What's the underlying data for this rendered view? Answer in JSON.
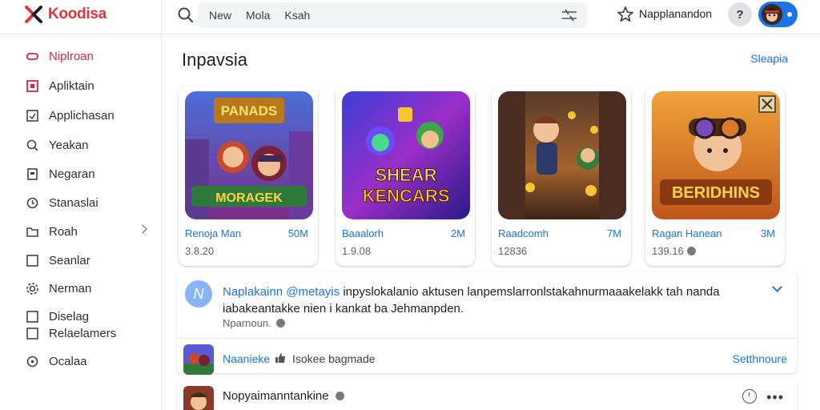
{
  "brand": {
    "name": "Koodisa",
    "accent": "#e53238"
  },
  "sidebar": {
    "items": [
      {
        "label": "Niplroan",
        "icon": "home-icon",
        "active": true
      },
      {
        "label": "Apliktain",
        "icon": "apps-icon"
      },
      {
        "label": "Applichasan",
        "icon": "application-icon"
      },
      {
        "label": "Yeakan",
        "icon": "search-icon"
      },
      {
        "label": "Negaran",
        "icon": "document-icon"
      },
      {
        "label": "Stanaslai",
        "icon": "clock-icon"
      },
      {
        "label": "Roah",
        "icon": "folder-icon",
        "expandable": true
      },
      {
        "label": "Seanlar",
        "icon": "square-icon"
      },
      {
        "label": "Nerman",
        "icon": "settings-icon"
      },
      {
        "label": "Diselag",
        "icon": "checkbox-icon"
      },
      {
        "label": "Relaelamers",
        "icon": "checkbox-icon"
      },
      {
        "label": "Ocalaa",
        "icon": "info-icon"
      }
    ]
  },
  "topbar": {
    "search_terms": [
      "New",
      "Mola",
      "Ksah"
    ],
    "account_name": "Napplanandon",
    "help_label": "?"
  },
  "main": {
    "title": "Inpavsia",
    "see_all": "Sleapia",
    "apps": [
      {
        "name": "Renoja Man",
        "size": "50M",
        "meta": "3.8.20",
        "art": "PANADS",
        "art2": "MORAGEK"
      },
      {
        "name": "Baaalorh",
        "size": "2M",
        "meta": "1.9.08",
        "art": "SHEAR",
        "art2": "KENCARS"
      },
      {
        "name": "Raadcomh",
        "size": "7M",
        "meta": "12836",
        "art": "",
        "art2": ""
      },
      {
        "name": "Ragan Hanean",
        "size": "3M",
        "meta": "139.16",
        "art": "BERIDHINS",
        "art2": ""
      }
    ],
    "post": {
      "author": "Naplakainn",
      "handle": "@metayis",
      "text": "inpyslokalanio aktusen lanpemslarronlstakahnurmaaakelakk tah nanda iabakeantakke nien i kankat ba Jehmanpden.",
      "subtext": "Nparnoun.",
      "app_link": "Naanieke",
      "like_text": "Isokee bagmade",
      "see_more": "Setthnoure"
    },
    "row2": {
      "title": "Nopyaimanntankine"
    }
  },
  "colors": {
    "link": "#1a73e8",
    "active": "#d7263d"
  }
}
